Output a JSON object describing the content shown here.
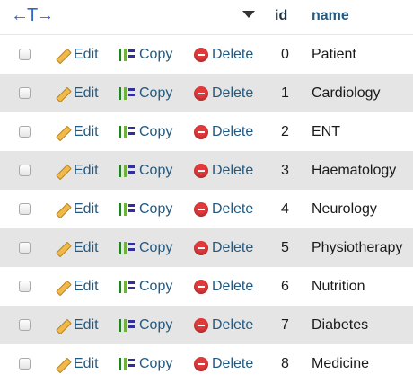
{
  "header": {
    "arrows": "←T→",
    "col_id": "id",
    "col_name": "name"
  },
  "actions": {
    "edit": "Edit",
    "copy": "Copy",
    "delete": "Delete"
  },
  "rows": [
    {
      "id": "0",
      "name": "Patient"
    },
    {
      "id": "1",
      "name": "Cardiology"
    },
    {
      "id": "2",
      "name": "ENT"
    },
    {
      "id": "3",
      "name": "Haematology"
    },
    {
      "id": "4",
      "name": "Neurology"
    },
    {
      "id": "5",
      "name": "Physiotherapy"
    },
    {
      "id": "6",
      "name": "Nutrition"
    },
    {
      "id": "7",
      "name": "Diabetes"
    },
    {
      "id": "8",
      "name": "Medicine"
    }
  ],
  "colors": {
    "link": "#235a81",
    "even_row": "#e5e5e5",
    "delete_icon": "#e2393b"
  }
}
